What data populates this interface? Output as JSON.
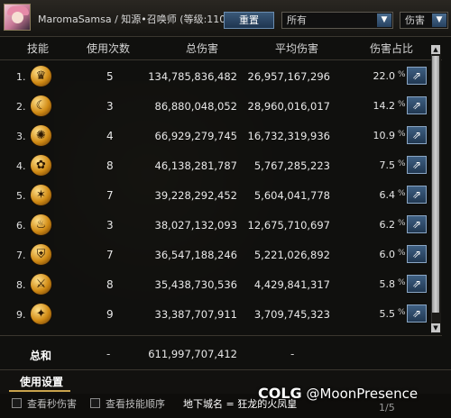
{
  "header": {
    "character_name": "MaromaSamsa / 知源•召唤师 (等级:110)",
    "reset_label": "重置",
    "filter_select": "所有",
    "metric_select": "伤害"
  },
  "columns": {
    "skill": "技能",
    "uses": "使用次数",
    "total": "总伤害",
    "avg": "平均伤害",
    "share": "伤害占比"
  },
  "rows": [
    {
      "index": "1.",
      "uses": "5",
      "total": "134,785,836,482",
      "avg": "26,957,167,296",
      "pct": "22.0",
      "pct_sign": "%",
      "icon": "crown-icon",
      "glyph": "♛"
    },
    {
      "index": "2.",
      "uses": "3",
      "total": "86,880,048,052",
      "avg": "28,960,016,017",
      "pct": "14.2",
      "pct_sign": "%",
      "icon": "crescent-icon",
      "glyph": "☾"
    },
    {
      "index": "3.",
      "uses": "4",
      "total": "66,929,279,745",
      "avg": "16,732,319,936",
      "pct": "10.9",
      "pct_sign": "%",
      "icon": "swirl-icon",
      "glyph": "✺"
    },
    {
      "index": "4.",
      "uses": "8",
      "total": "46,138,281,787",
      "avg": "5,767,285,223",
      "pct": "7.5",
      "pct_sign": "%",
      "icon": "flower-icon",
      "glyph": "✿"
    },
    {
      "index": "5.",
      "uses": "7",
      "total": "39,228,292,452",
      "avg": "5,604,041,778",
      "pct": "6.4",
      "pct_sign": "%",
      "icon": "star-burst-icon",
      "glyph": "✶"
    },
    {
      "index": "6.",
      "uses": "3",
      "total": "38,027,132,093",
      "avg": "12,675,710,697",
      "pct": "6.2",
      "pct_sign": "%",
      "icon": "flame-icon",
      "glyph": "♨"
    },
    {
      "index": "7.",
      "uses": "7",
      "total": "36,547,188,246",
      "avg": "5,221,026,892",
      "pct": "6.0",
      "pct_sign": "%",
      "icon": "shield-icon",
      "glyph": "⛨"
    },
    {
      "index": "8.",
      "uses": "8",
      "total": "35,438,730,536",
      "avg": "4,429,841,317",
      "pct": "5.8",
      "pct_sign": "%",
      "icon": "slash-icon",
      "glyph": "⚔"
    },
    {
      "index": "9.",
      "uses": "9",
      "total": "33,387,707,911",
      "avg": "3,709,745,323",
      "pct": "5.5",
      "pct_sign": "%",
      "icon": "claw-icon",
      "glyph": "✦"
    }
  ],
  "totals": {
    "label": "总和",
    "uses": "-",
    "total": "611,997,707,412",
    "avg": "-"
  },
  "settings": {
    "tab_label": "使用设置",
    "checkbox_dps": "查看秒伤害",
    "checkbox_order": "查看技能顺序",
    "dungeon": "地下城名 = 狂龙的火凤皇",
    "pager": "1/5"
  },
  "watermark": {
    "brand": "COLG",
    "handle": "@MoonPresence"
  },
  "colors": {
    "accent_blue": "#3a5878",
    "gold": "#c9a34c",
    "panel": "#12110f"
  }
}
